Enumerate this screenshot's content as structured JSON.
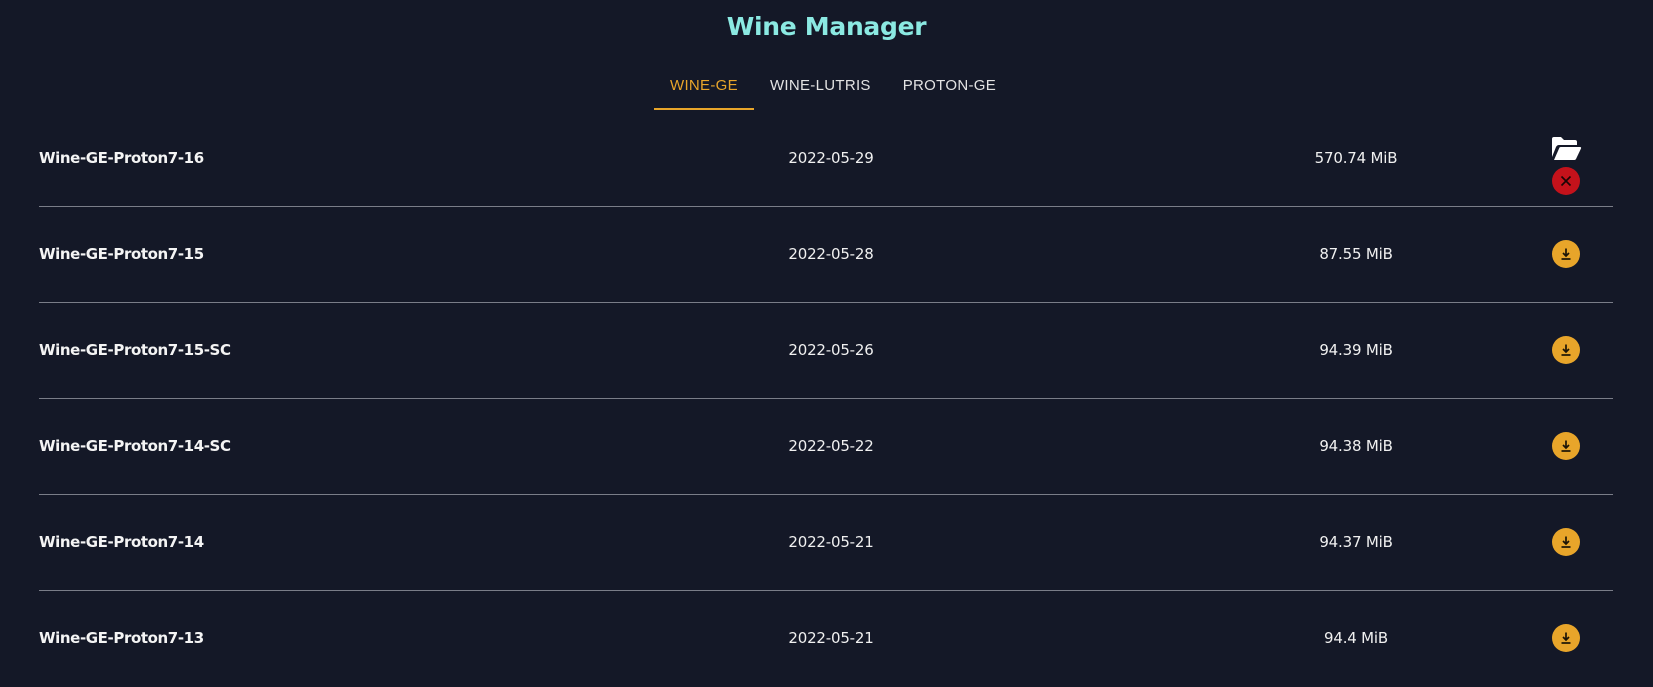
{
  "app": {
    "title": "Wine Manager"
  },
  "tabs": [
    {
      "label": "WINE-GE",
      "active": true
    },
    {
      "label": "WINE-LUTRIS",
      "active": false
    },
    {
      "label": "PROTON-GE",
      "active": false
    }
  ],
  "versions": [
    {
      "name": "Wine-GE-Proton7-16",
      "date": "2022-05-29",
      "size": "570.74 MiB",
      "installed": true
    },
    {
      "name": "Wine-GE-Proton7-15",
      "date": "2022-05-28",
      "size": "87.55 MiB",
      "installed": false
    },
    {
      "name": "Wine-GE-Proton7-15-SC",
      "date": "2022-05-26",
      "size": "94.39 MiB",
      "installed": false
    },
    {
      "name": "Wine-GE-Proton7-14-SC",
      "date": "2022-05-22",
      "size": "94.38 MiB",
      "installed": false
    },
    {
      "name": "Wine-GE-Proton7-14",
      "date": "2022-05-21",
      "size": "94.37 MiB",
      "installed": false
    },
    {
      "name": "Wine-GE-Proton7-13",
      "date": "2022-05-21",
      "size": "94.4 MiB",
      "installed": false
    }
  ],
  "icons": {
    "open": "folder-open-icon",
    "remove": "close-icon",
    "download": "download-icon"
  },
  "colors": {
    "background": "#141827",
    "title": "#8be9e2",
    "accent": "#e8a52a",
    "danger": "#c4121b",
    "divider": "#7a7d88"
  }
}
